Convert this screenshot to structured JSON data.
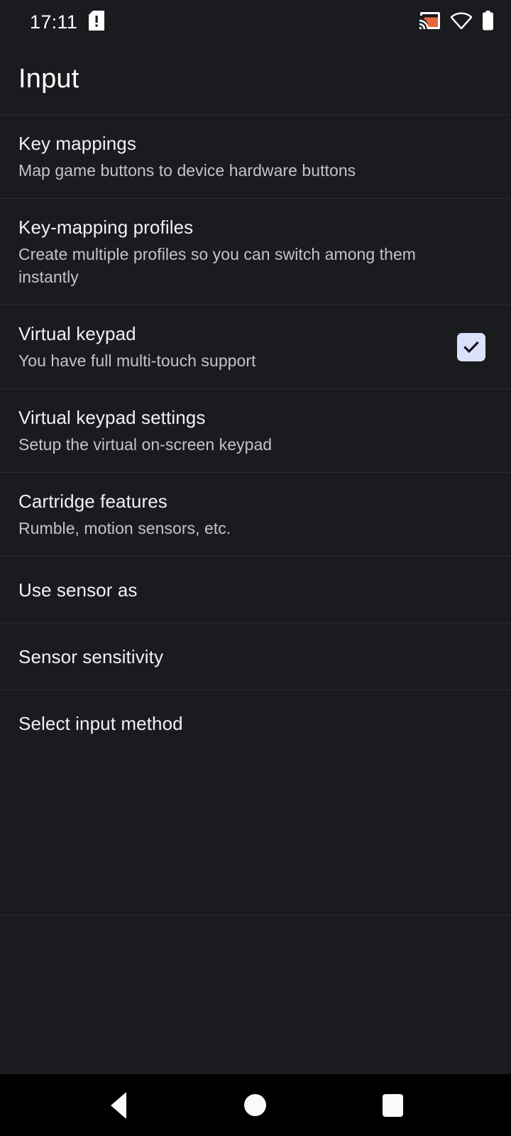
{
  "status_bar": {
    "time": "17:11",
    "icons": {
      "sim_alert": "sim-card-alert-icon",
      "cast": "cast-icon",
      "wifi": "wifi-icon",
      "battery": "battery-icon"
    },
    "colors": {
      "cast_accent": "#e8663c",
      "icon": "#ffffff"
    }
  },
  "header": {
    "title": "Input"
  },
  "theme": {
    "background": "#1a1b1f",
    "divider": "#2a2c31",
    "title_text": "#ffffff",
    "item_title_text": "#f1f1f3",
    "item_subtitle_text": "#c2c4c9",
    "checkbox_fill": "#dbe1fb",
    "checkbox_check": "#14151a",
    "navbar_background": "#000000",
    "navbar_icon": "#fafafa"
  },
  "list": {
    "items": [
      {
        "title": "Key mappings",
        "subtitle": "Map game buttons to device hardware buttons",
        "has_checkbox": false,
        "checked": false
      },
      {
        "title": "Key-mapping profiles",
        "subtitle": "Create multiple profiles so you can switch among them instantly",
        "has_checkbox": false,
        "checked": false
      },
      {
        "title": "Virtual keypad",
        "subtitle": "You have full multi-touch support",
        "has_checkbox": true,
        "checked": true
      },
      {
        "title": "Virtual keypad settings",
        "subtitle": "Setup the virtual on-screen keypad",
        "has_checkbox": false,
        "checked": false
      },
      {
        "title": "Cartridge features",
        "subtitle": "Rumble, motion sensors, etc.",
        "has_checkbox": false,
        "checked": false
      },
      {
        "title": "Use sensor as",
        "subtitle": "",
        "has_checkbox": false,
        "checked": false
      },
      {
        "title": "Sensor sensitivity",
        "subtitle": "",
        "has_checkbox": false,
        "checked": false
      },
      {
        "title": "Select input method",
        "subtitle": "",
        "has_checkbox": false,
        "checked": false
      }
    ]
  },
  "nav_bar": {
    "back_label": "Back",
    "home_label": "Home",
    "recents_label": "Recents"
  }
}
